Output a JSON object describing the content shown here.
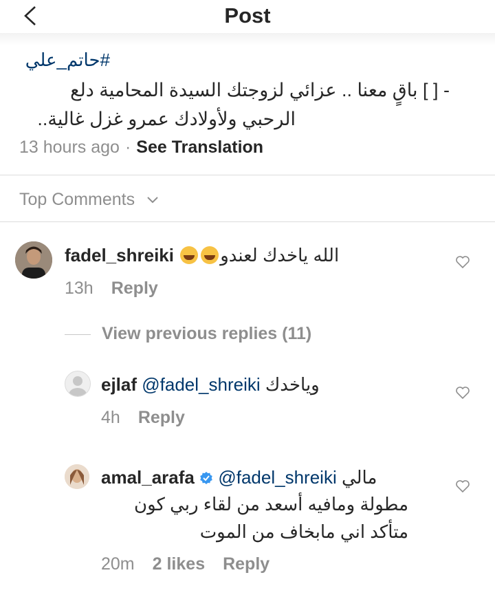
{
  "nav": {
    "title": "Post",
    "back_icon": "chevron-left-icon"
  },
  "caption": {
    "hashtag": "#حاتم_علي",
    "line1": "- [ ] باقٍ معنا .. عزائي لزوجتك السيدة المحامية دلع",
    "line2": "الرحبي ولأولادك عمرو غزل غالية..",
    "time": "13 hours ago",
    "separator": "·",
    "see_translation": "See Translation"
  },
  "top_comments": {
    "label": "Top Comments",
    "icon": "chevron-down-icon"
  },
  "comments": [
    {
      "username": "fadel_shreiki",
      "text": "الله ياخدك لعندو",
      "emoji": "laughing-tears-emoji",
      "time": "13h",
      "reply": "Reply"
    }
  ],
  "view_previous": "View previous replies (11)",
  "replies": [
    {
      "username": "ejlaf",
      "mention": "@fadel_shreiki",
      "text": "وياخدك",
      "time": "4h",
      "reply": "Reply"
    },
    {
      "username": "amal_arafa",
      "verified": true,
      "mention": "@fadel_shreiki",
      "text_line1": "مالي",
      "text_line2": "مطولة ومافيه أسعد من لقاء ربي كون",
      "text_line3": "متأكد اني مابخاف من الموت",
      "time": "20m",
      "likes": "2 likes",
      "reply": "Reply"
    }
  ],
  "colors": {
    "link": "#00376b",
    "muted": "#8e8e8e",
    "text": "#262626",
    "verified": "#3897f0"
  }
}
